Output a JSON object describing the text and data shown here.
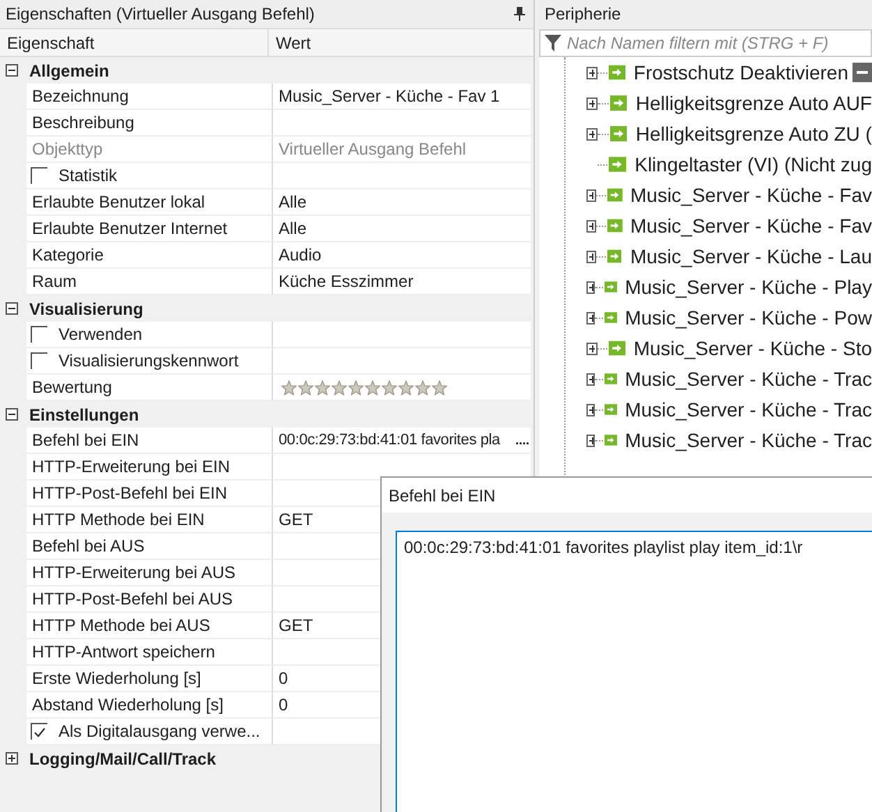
{
  "properties_panel": {
    "title": "Eigenschaften (Virtueller Ausgang Befehl)",
    "columns": [
      "Eigenschaft",
      "Wert"
    ],
    "categories": [
      {
        "title": "Allgemein",
        "expanded": true,
        "rows": [
          {
            "kind": "text",
            "label": "Bezeichnung",
            "value": "Music_Server - Küche - Fav 1"
          },
          {
            "kind": "text",
            "label": "Beschreibung"
          },
          {
            "kind": "text",
            "label": "Objekttyp",
            "value": "Virtueller Ausgang Befehl",
            "disabled": true
          },
          {
            "kind": "check",
            "label": "Statistik",
            "checked": false
          },
          {
            "kind": "text",
            "label": "Erlaubte Benutzer lokal",
            "value": "Alle"
          },
          {
            "kind": "text",
            "label": "Erlaubte Benutzer Internet",
            "value": "Alle"
          },
          {
            "kind": "text",
            "label": "Kategorie",
            "value": "Audio"
          },
          {
            "kind": "text",
            "label": "Raum",
            "value": "Küche Esszimmer"
          }
        ]
      },
      {
        "title": "Visualisierung",
        "expanded": true,
        "rows": [
          {
            "kind": "check",
            "label": "Verwenden",
            "checked": false
          },
          {
            "kind": "check",
            "label": "Visualisierungskennwort",
            "checked": false
          },
          {
            "kind": "stars",
            "label": "Bewertung",
            "stars": 0
          }
        ]
      },
      {
        "title": "Einstellungen",
        "expanded": true,
        "rows": [
          {
            "kind": "text",
            "label": "Befehl bei EIN",
            "value": "00:0c:29:73:bd:41:01 favorites pla",
            "button": "...."
          },
          {
            "kind": "text",
            "label": "HTTP-Erweiterung bei EIN"
          },
          {
            "kind": "text",
            "label": "HTTP-Post-Befehl bei EIN"
          },
          {
            "kind": "text",
            "label": "HTTP Methode bei EIN",
            "value": "GET"
          },
          {
            "kind": "text",
            "label": "Befehl bei AUS"
          },
          {
            "kind": "text",
            "label": "HTTP-Erweiterung bei AUS"
          },
          {
            "kind": "text",
            "label": "HTTP-Post-Befehl bei AUS"
          },
          {
            "kind": "text",
            "label": "HTTP Methode bei AUS",
            "value": "GET"
          },
          {
            "kind": "text",
            "label": "HTTP-Antwort speichern"
          },
          {
            "kind": "text",
            "label": "Erste Wiederholung [s]",
            "value": "0"
          },
          {
            "kind": "text",
            "label": "Abstand Wiederholung [s]",
            "value": "0"
          },
          {
            "kind": "check",
            "label": "Als Digitalausgang verwe...",
            "checked": true
          }
        ]
      },
      {
        "title": "Logging/Mail/Call/Track",
        "expanded": false
      }
    ]
  },
  "peripherals_panel": {
    "title": "Peripherie",
    "filter": {
      "placeholder": "Nach Namen filtern mit (STRG + F)"
    },
    "items": [
      {
        "label": "Frostschutz Deaktivieren",
        "has_children": true,
        "remove_button": true
      },
      {
        "label": "Helligkeitsgrenze Auto AUF",
        "has_children": true
      },
      {
        "label": "Helligkeitsgrenze Auto ZU (",
        "has_children": true
      },
      {
        "label": "Klingeltaster (VI) (Nicht zug",
        "has_children": false
      },
      {
        "label": "Music_Server - Küche - Fav",
        "has_children": true
      },
      {
        "label": "Music_Server - Küche - Fav",
        "has_children": true
      },
      {
        "label": "Music_Server - Küche - Lau",
        "has_children": true
      },
      {
        "label": "Music_Server - Küche - Play",
        "has_children": true
      },
      {
        "label": "Music_Server - Küche - Pow",
        "has_children": true
      },
      {
        "label": "Music_Server - Küche - Sto",
        "has_children": true
      },
      {
        "label": "Music_Server - Küche - Trac",
        "has_children": true
      },
      {
        "label": "Music_Server - Küche - Trac",
        "has_children": true
      },
      {
        "label": "Music_Server - Küche - Trac",
        "has_children": true
      }
    ]
  },
  "dialog": {
    "title": "Befehl bei EIN",
    "value": "00:0c:29:73:bd:41:01 favorites playlist play item_id:1\\r"
  }
}
